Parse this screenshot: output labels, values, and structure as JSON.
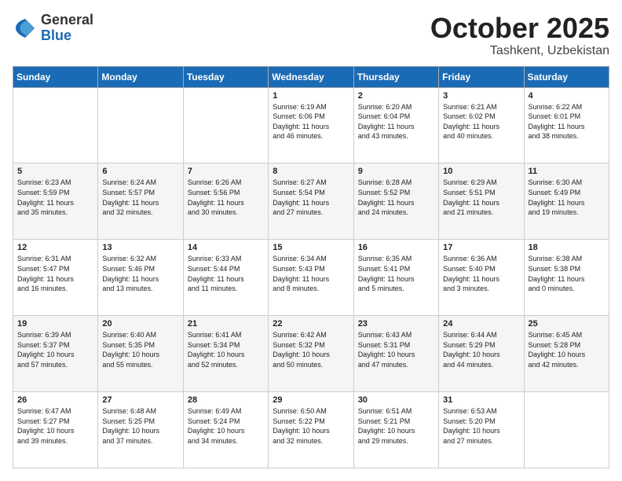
{
  "logo": {
    "general": "General",
    "blue": "Blue"
  },
  "title": {
    "month": "October 2025",
    "location": "Tashkent, Uzbekistan"
  },
  "days_of_week": [
    "Sunday",
    "Monday",
    "Tuesday",
    "Wednesday",
    "Thursday",
    "Friday",
    "Saturday"
  ],
  "weeks": [
    [
      {
        "day": "",
        "info": ""
      },
      {
        "day": "",
        "info": ""
      },
      {
        "day": "",
        "info": ""
      },
      {
        "day": "1",
        "info": "Sunrise: 6:19 AM\nSunset: 6:06 PM\nDaylight: 11 hours\nand 46 minutes."
      },
      {
        "day": "2",
        "info": "Sunrise: 6:20 AM\nSunset: 6:04 PM\nDaylight: 11 hours\nand 43 minutes."
      },
      {
        "day": "3",
        "info": "Sunrise: 6:21 AM\nSunset: 6:02 PM\nDaylight: 11 hours\nand 40 minutes."
      },
      {
        "day": "4",
        "info": "Sunrise: 6:22 AM\nSunset: 6:01 PM\nDaylight: 11 hours\nand 38 minutes."
      }
    ],
    [
      {
        "day": "5",
        "info": "Sunrise: 6:23 AM\nSunset: 5:59 PM\nDaylight: 11 hours\nand 35 minutes."
      },
      {
        "day": "6",
        "info": "Sunrise: 6:24 AM\nSunset: 5:57 PM\nDaylight: 11 hours\nand 32 minutes."
      },
      {
        "day": "7",
        "info": "Sunrise: 6:26 AM\nSunset: 5:56 PM\nDaylight: 11 hours\nand 30 minutes."
      },
      {
        "day": "8",
        "info": "Sunrise: 6:27 AM\nSunset: 5:54 PM\nDaylight: 11 hours\nand 27 minutes."
      },
      {
        "day": "9",
        "info": "Sunrise: 6:28 AM\nSunset: 5:52 PM\nDaylight: 11 hours\nand 24 minutes."
      },
      {
        "day": "10",
        "info": "Sunrise: 6:29 AM\nSunset: 5:51 PM\nDaylight: 11 hours\nand 21 minutes."
      },
      {
        "day": "11",
        "info": "Sunrise: 6:30 AM\nSunset: 5:49 PM\nDaylight: 11 hours\nand 19 minutes."
      }
    ],
    [
      {
        "day": "12",
        "info": "Sunrise: 6:31 AM\nSunset: 5:47 PM\nDaylight: 11 hours\nand 16 minutes."
      },
      {
        "day": "13",
        "info": "Sunrise: 6:32 AM\nSunset: 5:46 PM\nDaylight: 11 hours\nand 13 minutes."
      },
      {
        "day": "14",
        "info": "Sunrise: 6:33 AM\nSunset: 5:44 PM\nDaylight: 11 hours\nand 11 minutes."
      },
      {
        "day": "15",
        "info": "Sunrise: 6:34 AM\nSunset: 5:43 PM\nDaylight: 11 hours\nand 8 minutes."
      },
      {
        "day": "16",
        "info": "Sunrise: 6:35 AM\nSunset: 5:41 PM\nDaylight: 11 hours\nand 5 minutes."
      },
      {
        "day": "17",
        "info": "Sunrise: 6:36 AM\nSunset: 5:40 PM\nDaylight: 11 hours\nand 3 minutes."
      },
      {
        "day": "18",
        "info": "Sunrise: 6:38 AM\nSunset: 5:38 PM\nDaylight: 11 hours\nand 0 minutes."
      }
    ],
    [
      {
        "day": "19",
        "info": "Sunrise: 6:39 AM\nSunset: 5:37 PM\nDaylight: 10 hours\nand 57 minutes."
      },
      {
        "day": "20",
        "info": "Sunrise: 6:40 AM\nSunset: 5:35 PM\nDaylight: 10 hours\nand 55 minutes."
      },
      {
        "day": "21",
        "info": "Sunrise: 6:41 AM\nSunset: 5:34 PM\nDaylight: 10 hours\nand 52 minutes."
      },
      {
        "day": "22",
        "info": "Sunrise: 6:42 AM\nSunset: 5:32 PM\nDaylight: 10 hours\nand 50 minutes."
      },
      {
        "day": "23",
        "info": "Sunrise: 6:43 AM\nSunset: 5:31 PM\nDaylight: 10 hours\nand 47 minutes."
      },
      {
        "day": "24",
        "info": "Sunrise: 6:44 AM\nSunset: 5:29 PM\nDaylight: 10 hours\nand 44 minutes."
      },
      {
        "day": "25",
        "info": "Sunrise: 6:45 AM\nSunset: 5:28 PM\nDaylight: 10 hours\nand 42 minutes."
      }
    ],
    [
      {
        "day": "26",
        "info": "Sunrise: 6:47 AM\nSunset: 5:27 PM\nDaylight: 10 hours\nand 39 minutes."
      },
      {
        "day": "27",
        "info": "Sunrise: 6:48 AM\nSunset: 5:25 PM\nDaylight: 10 hours\nand 37 minutes."
      },
      {
        "day": "28",
        "info": "Sunrise: 6:49 AM\nSunset: 5:24 PM\nDaylight: 10 hours\nand 34 minutes."
      },
      {
        "day": "29",
        "info": "Sunrise: 6:50 AM\nSunset: 5:22 PM\nDaylight: 10 hours\nand 32 minutes."
      },
      {
        "day": "30",
        "info": "Sunrise: 6:51 AM\nSunset: 5:21 PM\nDaylight: 10 hours\nand 29 minutes."
      },
      {
        "day": "31",
        "info": "Sunrise: 6:53 AM\nSunset: 5:20 PM\nDaylight: 10 hours\nand 27 minutes."
      },
      {
        "day": "",
        "info": ""
      }
    ]
  ]
}
